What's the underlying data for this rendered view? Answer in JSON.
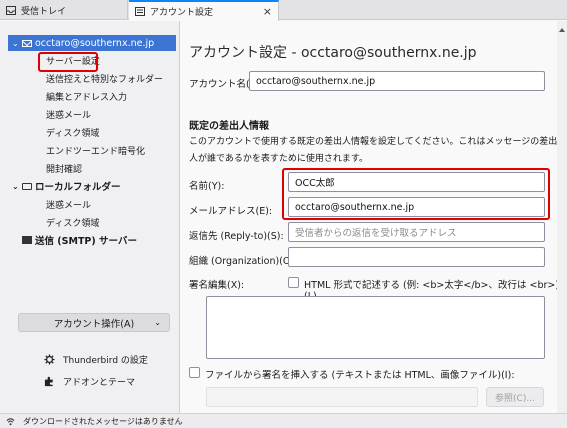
{
  "tabs": [
    {
      "label": "受信トレイ"
    },
    {
      "label": "アカウント設定"
    }
  ],
  "tree": {
    "account": "occtaro@southernx.ne.jp",
    "account_items": [
      "サーバー設定",
      "送信控えと特別なフォルダー",
      "編集とアドレス入力",
      "迷惑メール",
      "ディスク領域",
      "エンドツーエンド暗号化",
      "開封確認"
    ],
    "local_folders": "ローカルフォルダー",
    "local_items": [
      "迷惑メール",
      "ディスク領域"
    ],
    "smtp": "送信 (SMTP) サーバー"
  },
  "account_actions": "アカウント操作(A)",
  "left_links": [
    "Thunderbird の設定",
    "アドオンとテーマ"
  ],
  "main": {
    "title": "アカウント設定 - occtaro@southernx.ne.jp",
    "account_name_label": "アカウント名(N):",
    "account_name_value": "occtaro@southernx.ne.jp",
    "section_title": "既定の差出人情報",
    "section_desc": "このアカウントで使用する既定の差出人情報を設定してください。これはメッセージの差出人が誰であるかを表すために使用されます。",
    "name_label": "名前(Y):",
    "name_value": "OCC太郎",
    "email_label": "メールアドレス(E):",
    "email_value": "occtaro@southernx.ne.jp",
    "replyto_label": "返信先 (Reply-to)(S):",
    "replyto_placeholder": "受信者からの返信を受け取るアドレス",
    "org_label": "組織 (Organization)(O):",
    "org_value": "",
    "signature_label": "署名編集(X):",
    "html_checkbox_label": "HTML 形式で記述する (例: <b>太字</b>、改行は <br>)(L)",
    "file_sig_label": "ファイルから署名を挿入する (テキストまたは HTML、画像ファイル)(I):",
    "browse_button": "参照(C)..."
  },
  "status": {
    "text": "ダウンロードされたメッセージはありません"
  },
  "colors": {
    "accent": "#0a84ff",
    "selection": "#3b74d3",
    "highlight": "#e00000"
  }
}
